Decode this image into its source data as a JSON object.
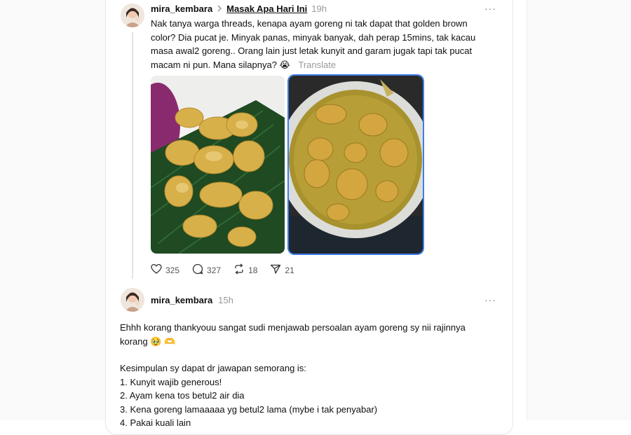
{
  "post": {
    "username": "mira_kembara",
    "community": "Masak Apa Hari Ini",
    "time": "19h",
    "text": "Nak tanya warga threads, kenapa ayam goreng ni tak dapat that golden brown color? Dia pucat je. Minyak panas, minyak banyak, dah perap 15mins, tak kacau masa awal2 goreng.. Orang lain just letak kunyit and garam jugak tapi tak pucat macam ni pun. Mana silapnya? 😭",
    "translate_label": "Translate",
    "likes": "325",
    "replies": "327",
    "reposts": "18",
    "shares": "21"
  },
  "reply": {
    "username": "mira_kembara",
    "time": "15h",
    "text1": "Ehhh korang thankyouu sangat sudi menjawab persoalan ayam goreng sy nii rajinnya korang 🥹 🫶",
    "text2": "Kesimpulan sy dapat dr jawapan semorang is:",
    "list": [
      "1. Kunyit wajib generous!",
      "2. Ayam kena tos betul2 air dia",
      "3. Kena goreng lamaaaaa yg betul2 lama (mybe i tak penyabar)",
      "4. Pakai kuali lain"
    ]
  },
  "colors": {
    "accent": "#3d7de8",
    "muted": "#999999",
    "text": "#101010"
  },
  "icons": [
    "heart-icon",
    "comment-icon",
    "repost-icon",
    "share-icon",
    "more-icon",
    "chevron-right-icon"
  ]
}
